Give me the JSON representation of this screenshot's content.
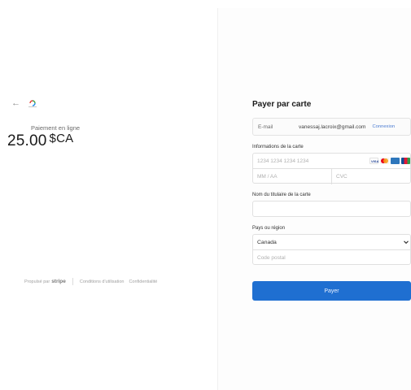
{
  "left": {
    "back_icon": "back-arrow-icon",
    "merchant_logo": "merchant-logo-icon",
    "payment_label": "Paiement en ligne",
    "amount": "25.00",
    "currency": "$CA",
    "footer": {
      "powered_by": "Propulsé par",
      "brand": "stripe",
      "terms": "Conditions d'utilisation",
      "privacy": "Confidentialité"
    }
  },
  "form": {
    "title": "Payer par carte",
    "email": {
      "label": "E-mail",
      "value": "vanessaj.lacroix@gmail.com",
      "link": "Connexion"
    },
    "card": {
      "label": "Informations de la carte",
      "number_placeholder": "1234 1234 1234 1234",
      "expiry_placeholder": "MM / AA",
      "cvc_placeholder": "CVC",
      "brands": [
        "visa-icon",
        "mastercard-icon",
        "amex-icon",
        "jcb-icon"
      ]
    },
    "cardholder": {
      "label": "Nom du titulaire de la carte",
      "value": ""
    },
    "region": {
      "label": "Pays ou région",
      "selected": "Canada",
      "postal_placeholder": "Code postal"
    },
    "submit_label": "Payer"
  },
  "colors": {
    "accent": "#1f6fd1",
    "link": "#4a7bd1"
  }
}
